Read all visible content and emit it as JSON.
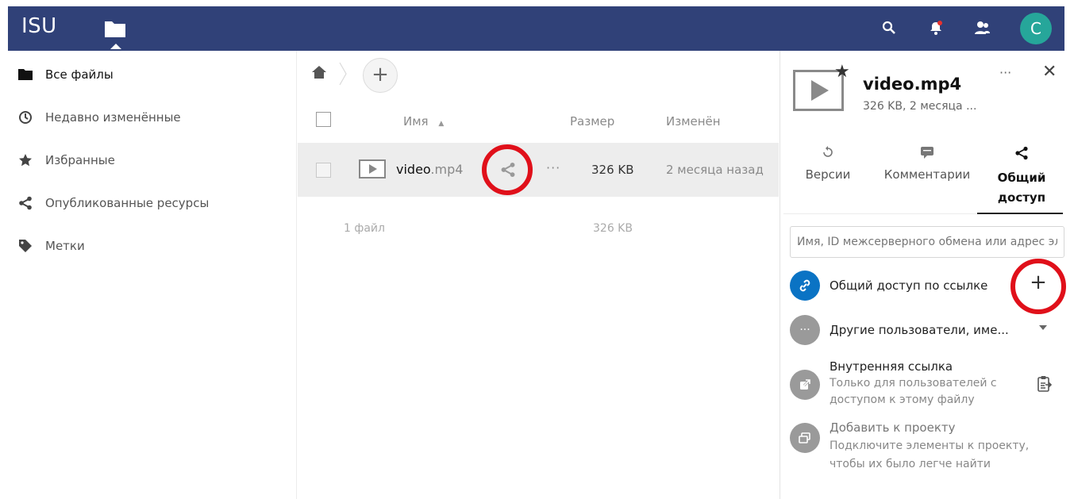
{
  "header": {
    "brand": "ISU",
    "avatar_initial": "C",
    "icons": [
      "folder-icon",
      "search-icon",
      "notifications-icon",
      "contacts-icon"
    ],
    "bar_color": "#304178",
    "avatar_color": "#26a69a"
  },
  "sidebar": {
    "items": [
      {
        "label": "Все файлы",
        "icon": "folder-icon",
        "active": true
      },
      {
        "label": "Недавно изменённые",
        "icon": "clock-icon"
      },
      {
        "label": "Избранные",
        "icon": "star-icon"
      },
      {
        "label": "Опубликованные ресурсы",
        "icon": "share-icon"
      },
      {
        "label": "Метки",
        "icon": "tag-icon"
      }
    ]
  },
  "files": {
    "columns": {
      "name": "Имя",
      "size": "Размер",
      "modified": "Изменён"
    },
    "rows": [
      {
        "name_base": "video",
        "name_ext": ".mp4",
        "size": "326 KB",
        "modified": "2 месяца назад"
      }
    ],
    "summary": {
      "count": "1 файл",
      "size": "326 KB"
    },
    "highlight_color": "#e0101a"
  },
  "details": {
    "title": "video.mp4",
    "subtitle": "326 KB, 2 месяца ...",
    "tabs": [
      {
        "label": "Версии",
        "icon": "history-icon"
      },
      {
        "label": "Комментарии",
        "icon": "comment-icon"
      },
      {
        "label": "Общий доступ",
        "icon": "share-icon",
        "active": true
      }
    ],
    "share_input_placeholder": "Имя, ID межсерверного обмена или адрес эл. почты",
    "share_link_label": "Общий доступ по ссылке",
    "other_users_label": "Другие пользователи, име...",
    "internal_link": {
      "title": "Внутренняя ссылка",
      "desc_line1": "Только для пользователей с",
      "desc_line2": "доступом к этому файлу"
    },
    "add_project": {
      "title": "Добавить к проекту",
      "desc_line1": "Подключите элементы к проекту,",
      "desc_line2": "чтобы их было легче найти"
    }
  }
}
